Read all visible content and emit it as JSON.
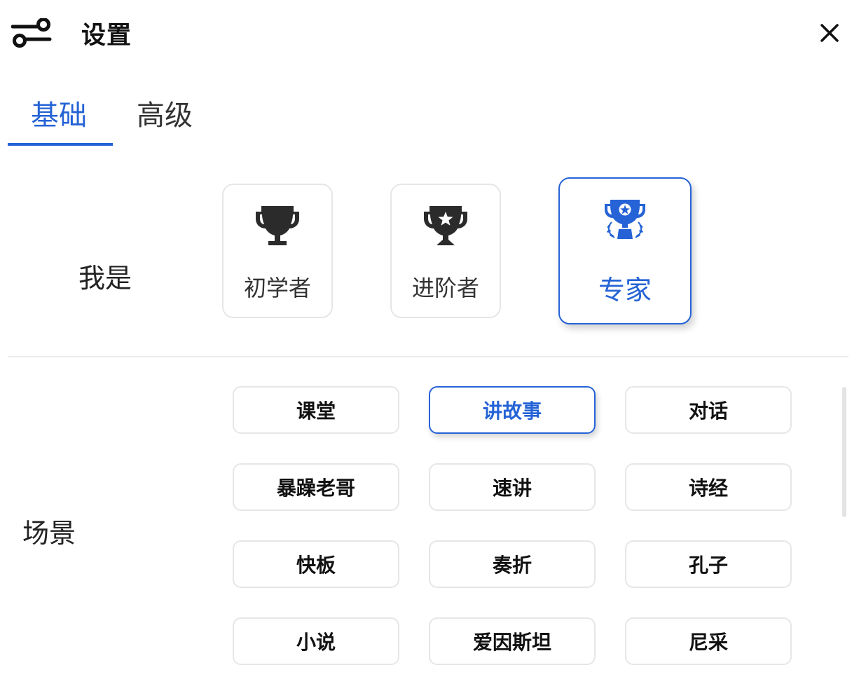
{
  "header": {
    "title": "设置",
    "settings_icon": "settings-toggle-icon",
    "close_icon": "close-icon"
  },
  "tabs": [
    {
      "label": "基础",
      "active": true
    },
    {
      "label": "高级",
      "active": false
    }
  ],
  "level": {
    "label": "我是",
    "options": [
      {
        "label": "初学者",
        "icon": "trophy-icon",
        "selected": false
      },
      {
        "label": "进阶者",
        "icon": "trophy-star-icon",
        "selected": false
      },
      {
        "label": "专家",
        "icon": "trophy-laurel-icon",
        "selected": true
      }
    ]
  },
  "scene": {
    "label": "场景",
    "options": [
      {
        "label": "课堂",
        "selected": false
      },
      {
        "label": "讲故事",
        "selected": true
      },
      {
        "label": "对话",
        "selected": false
      },
      {
        "label": "暴躁老哥",
        "selected": false
      },
      {
        "label": "速讲",
        "selected": false
      },
      {
        "label": "诗经",
        "selected": false
      },
      {
        "label": "快板",
        "selected": false
      },
      {
        "label": "奏折",
        "selected": false
      },
      {
        "label": "孔子",
        "selected": false
      },
      {
        "label": "小说",
        "selected": false
      },
      {
        "label": "爱因斯坦",
        "selected": false
      },
      {
        "label": "尼采",
        "selected": false
      }
    ]
  },
  "colors": {
    "accent": "#2563d6",
    "border": "#e6e6e6",
    "text": "#111111"
  }
}
